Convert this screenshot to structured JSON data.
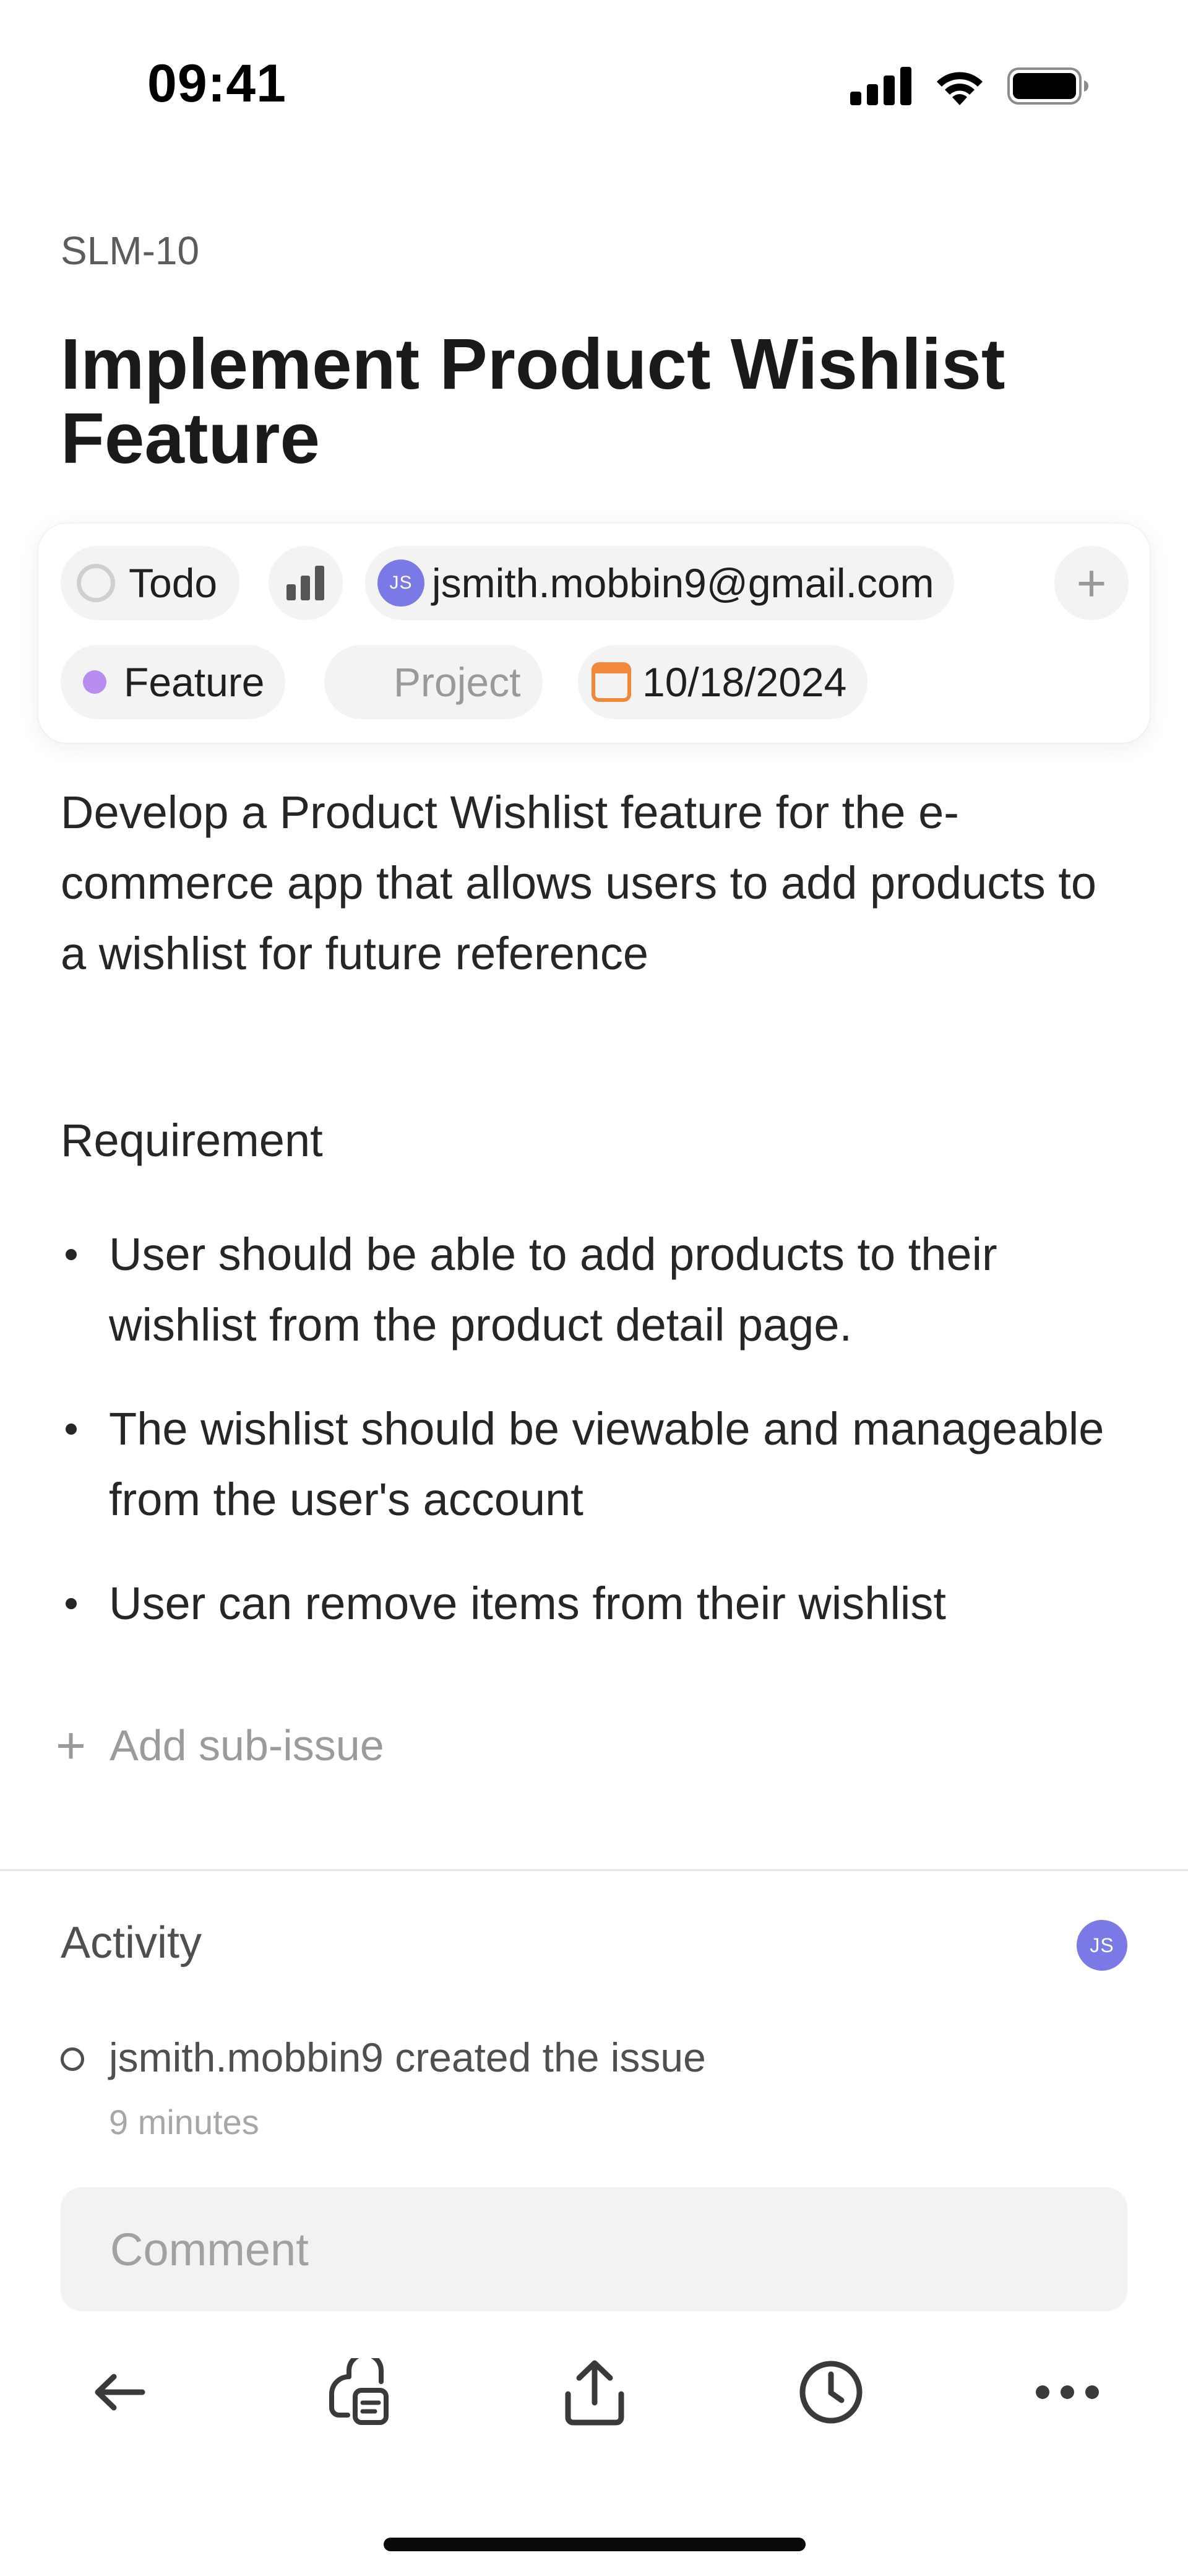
{
  "status_bar": {
    "time": "09:41",
    "icons": [
      "signal-icon",
      "wifi-icon",
      "battery-icon"
    ]
  },
  "issue": {
    "id": "SLM-10",
    "title": "Implement Product Wishlist Feature"
  },
  "properties": {
    "status": "Todo",
    "priority_icon": "priority-bars-icon",
    "assignee_initials": "JS",
    "assignee": "jsmith.mobbin9@gmail.com",
    "add": "+",
    "label": "Feature",
    "label_color": "#b98cf0",
    "project": "Project",
    "due_date": "10/18/2024",
    "due_date_color": "#f0893a"
  },
  "description": "Develop a Product Wishlist feature for the e-commerce app that allows users to add products to a wishlist for future reference",
  "requirements": {
    "heading": "Requirement",
    "items": [
      "User should be able to add products to their wishlist from the product detail page.",
      "The wishlist should be viewable and manageable from the user's account",
      "User can remove items from their wishlist"
    ]
  },
  "sub_issue": {
    "plus": "+",
    "label": "Add sub-issue"
  },
  "activity": {
    "title": "Activity",
    "avatar_initials": "JS",
    "entries": [
      {
        "text": "jsmith.mobbin9 created the issue",
        "time": "9 minutes"
      }
    ]
  },
  "comment": {
    "placeholder": "Comment"
  },
  "toolbar": {
    "icons": [
      "back-arrow-icon",
      "copy-link-icon",
      "share-icon",
      "history-icon",
      "more-icon"
    ]
  },
  "colors": {
    "avatar": "#7b79e6",
    "chip_bg": "#f3f3f3"
  }
}
